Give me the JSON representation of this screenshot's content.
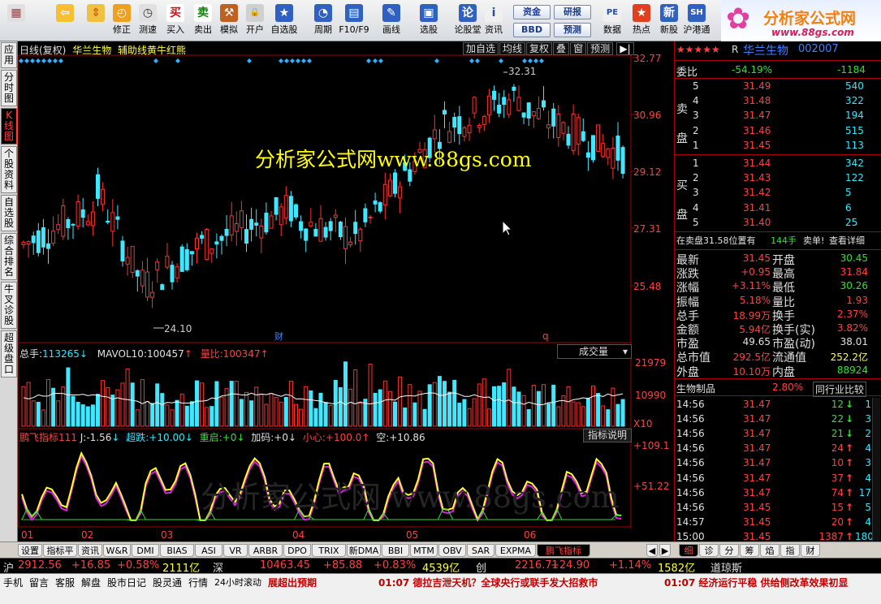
{
  "toolbar": {
    "items": [
      {
        "label": "",
        "icon": "grid-icon"
      },
      {
        "label": "",
        "icon": "back-arrow-icon"
      },
      {
        "label": "",
        "icon": "up-down-icon"
      },
      {
        "label": "修正",
        "icon": "clock-icon"
      },
      {
        "label": "测速",
        "icon": "stopwatch-icon"
      },
      {
        "label": "买入",
        "icon": "buy-icon"
      },
      {
        "label": "卖出",
        "icon": "sell-icon"
      },
      {
        "label": "模拟",
        "icon": "hammer-icon"
      },
      {
        "label": "开户",
        "icon": "lock-icon"
      },
      {
        "label": "自选股",
        "icon": "star-icon"
      },
      {
        "label": "周期",
        "icon": "period-icon"
      },
      {
        "label": "F10/F9",
        "icon": "f10-icon"
      },
      {
        "label": "画线",
        "icon": "pencil-icon"
      },
      {
        "label": "选股",
        "icon": "screen-icon"
      },
      {
        "label": "论股堂",
        "icon": "forum-icon"
      },
      {
        "label": "资讯",
        "icon": "info-icon"
      },
      {
        "label": "数据",
        "icon": "pe-icon"
      },
      {
        "label": "热点",
        "icon": "hot-icon"
      },
      {
        "label": "新股",
        "icon": "newstock-icon"
      },
      {
        "label": "沪港通",
        "icon": "shhk-icon"
      }
    ],
    "mini": [
      "资金",
      "BBD",
      "研报",
      "预测"
    ]
  },
  "logo": {
    "title": "分析家公式网",
    "url": "www.88gs.com"
  },
  "lefttabs": [
    "应用",
    "分时图",
    "K线图",
    "个股资料",
    "自选股",
    "综合排名",
    "牛叉诊股",
    "超级盘口"
  ],
  "header": {
    "period": "日线(复权)",
    "stock": "华兰生物",
    "indicator": "辅助线黄牛红熊"
  },
  "buttons": [
    "加自选",
    "均线",
    "复权",
    "叠",
    "窗",
    "预测"
  ],
  "watermark": "分析家公式网www.88gs.com",
  "watermark2": "分析家公式网 www.88gs.com",
  "price_axis": [
    "32.77",
    "30.96",
    "29.12",
    "27.31",
    "25.48"
  ],
  "annotations": {
    "high": "32.31",
    "low": "24.10",
    "cai": "财",
    "q": "q"
  },
  "volume": {
    "label": "总手:",
    "value": "113265",
    "ma_label": "MAVOL10:",
    "ma_value": "100457",
    "ratio_label": "量比:",
    "ratio_value": "100347",
    "dropdown": "成交量",
    "axis": [
      "21979",
      "10990",
      "X10"
    ]
  },
  "indicator": {
    "name": "鹏飞指标111",
    "j": "J:-1.56",
    "chaodie": "超跌:+10.00",
    "chongqi": "重启:+0",
    "jiama": "加码:+0",
    "xiaoxin": "小心:+100.0",
    "kong": "空:+10.86",
    "button": "指标说明",
    "axis": [
      "+109.1",
      "+51.22"
    ]
  },
  "months": [
    "01",
    "02",
    "03",
    "04",
    "05",
    "06"
  ],
  "stock_title": {
    "prefix": "R",
    "name": "华兰生物",
    "code": "002007",
    "stars": "★★★★★"
  },
  "weibi": {
    "label": "委比",
    "pct": "-54.19%",
    "diff": "-1184"
  },
  "sell_label": [
    "卖",
    "盘"
  ],
  "buy_label": [
    "买",
    "盘"
  ],
  "asks": [
    {
      "n": "5",
      "p": "31.49",
      "v": "540"
    },
    {
      "n": "4",
      "p": "31.48",
      "v": "322"
    },
    {
      "n": "3",
      "p": "31.47",
      "v": "194"
    },
    {
      "n": "2",
      "p": "31.46",
      "v": "515"
    },
    {
      "n": "1",
      "p": "31.45",
      "v": "113"
    }
  ],
  "bids": [
    {
      "n": "1",
      "p": "31.44",
      "v": "342"
    },
    {
      "n": "2",
      "p": "31.43",
      "v": "122"
    },
    {
      "n": "3",
      "p": "31.42",
      "v": "5"
    },
    {
      "n": "4",
      "p": "31.41",
      "v": "6"
    },
    {
      "n": "5",
      "p": "31.40",
      "v": "25"
    }
  ],
  "zaimai": {
    "a": "在卖盘31.58位置有",
    "b": "144手",
    "c": "卖单!",
    "d": "查看详细"
  },
  "quote": [
    {
      "l1": "最新",
      "v1": "31.45",
      "l2": "开盘",
      "v2": "30.45"
    },
    {
      "l1": "涨跌",
      "v1": "+0.95",
      "l2": "最高",
      "v2": "31.84"
    },
    {
      "l1": "涨幅",
      "v1": "+3.11%",
      "l2": "最低",
      "v2": "30.26"
    },
    {
      "l1": "振幅",
      "v1": "5.18%",
      "l2": "量比",
      "v2": "1.93"
    },
    {
      "l1": "总手",
      "v1": "18.99万",
      "l2": "换手",
      "v2": "2.37%"
    },
    {
      "l1": "金额",
      "v1": "5.94亿",
      "l2": "换手(实)",
      "v2": "3.82%"
    },
    {
      "l1": "市盈",
      "v1": "49.65",
      "l2": "市盈(动)",
      "v2": "38.01"
    },
    {
      "l1": "总市值",
      "v1": "292.5亿",
      "l2": "流通值",
      "v2": "252.2亿"
    },
    {
      "l1": "外盘",
      "v1": "10.10万",
      "l2": "内盘",
      "v2": "88924"
    }
  ],
  "industry": {
    "name": "生物制品",
    "pct": "2.80%",
    "btn": "同行业比较"
  },
  "ticks": [
    {
      "t": "14:56",
      "p": "31.47",
      "v": "12",
      "d": "down",
      "n": "1"
    },
    {
      "t": "14:56",
      "p": "31.47",
      "v": "22",
      "d": "down",
      "n": "3"
    },
    {
      "t": "14:56",
      "p": "31.47",
      "v": "21",
      "d": "down",
      "n": "2"
    },
    {
      "t": "14:56",
      "p": "31.47",
      "v": "24",
      "d": "up",
      "n": "4"
    },
    {
      "t": "14:56",
      "p": "31.47",
      "v": "10",
      "d": "up",
      "n": "3"
    },
    {
      "t": "14:56",
      "p": "31.47",
      "v": "37",
      "d": "up",
      "n": "4"
    },
    {
      "t": "14:56",
      "p": "31.47",
      "v": "74",
      "d": "up",
      "n": "17"
    },
    {
      "t": "14:56",
      "p": "31.45",
      "v": "15",
      "d": "up",
      "n": "5"
    },
    {
      "t": "14:57",
      "p": "31.45",
      "v": "20",
      "d": "up",
      "n": "4"
    },
    {
      "t": "15:00",
      "p": "31.45",
      "v": "1387",
      "d": "up",
      "n": "180"
    }
  ],
  "bottomtabs": [
    "设置",
    "指标平台",
    "资讯",
    "W&R",
    "DMI",
    "BIAS",
    "ASI",
    "VR",
    "ARBR",
    "DPO",
    "TRIX",
    "新DMA",
    "BBI",
    "MTM",
    "OBV",
    "SAR",
    "EXPMA",
    "鹏飞指标111"
  ],
  "righttabs": [
    "细",
    "诊",
    "分",
    "筹",
    "焰",
    "指",
    "财"
  ],
  "index": [
    {
      "t": "沪",
      "c": "w"
    },
    {
      "t": "2912.56",
      "c": "r"
    },
    {
      "t": "+16.85",
      "c": "r"
    },
    {
      "t": "+0.58%",
      "c": "r"
    },
    {
      "t": "2111亿",
      "c": "y"
    },
    {
      "t": "深",
      "c": "w"
    },
    {
      "t": "10463.45",
      "c": "r"
    },
    {
      "t": "+85.88",
      "c": "r"
    },
    {
      "t": "+0.83%",
      "c": "r"
    },
    {
      "t": "4539亿",
      "c": "y"
    },
    {
      "t": "创",
      "c": "w"
    },
    {
      "t": "2216.71",
      "c": "r"
    },
    {
      "t": "+24.90",
      "c": "r"
    },
    {
      "t": "+1.14%",
      "c": "r"
    },
    {
      "t": "1582亿",
      "c": "y"
    },
    {
      "t": "道琼斯",
      "c": "w"
    }
  ],
  "status": {
    "items": [
      "手机",
      "留言",
      "客服",
      "解盘",
      "股市日记",
      "股灵通",
      "行情",
      "24小时滚动"
    ],
    "news1": "展超出预期",
    "news2": "01:07 德拉吉泄天机？全球央行或联手发大招救市",
    "news3": "01:07 经济运行平稳 供给侧改革效果初显"
  }
}
